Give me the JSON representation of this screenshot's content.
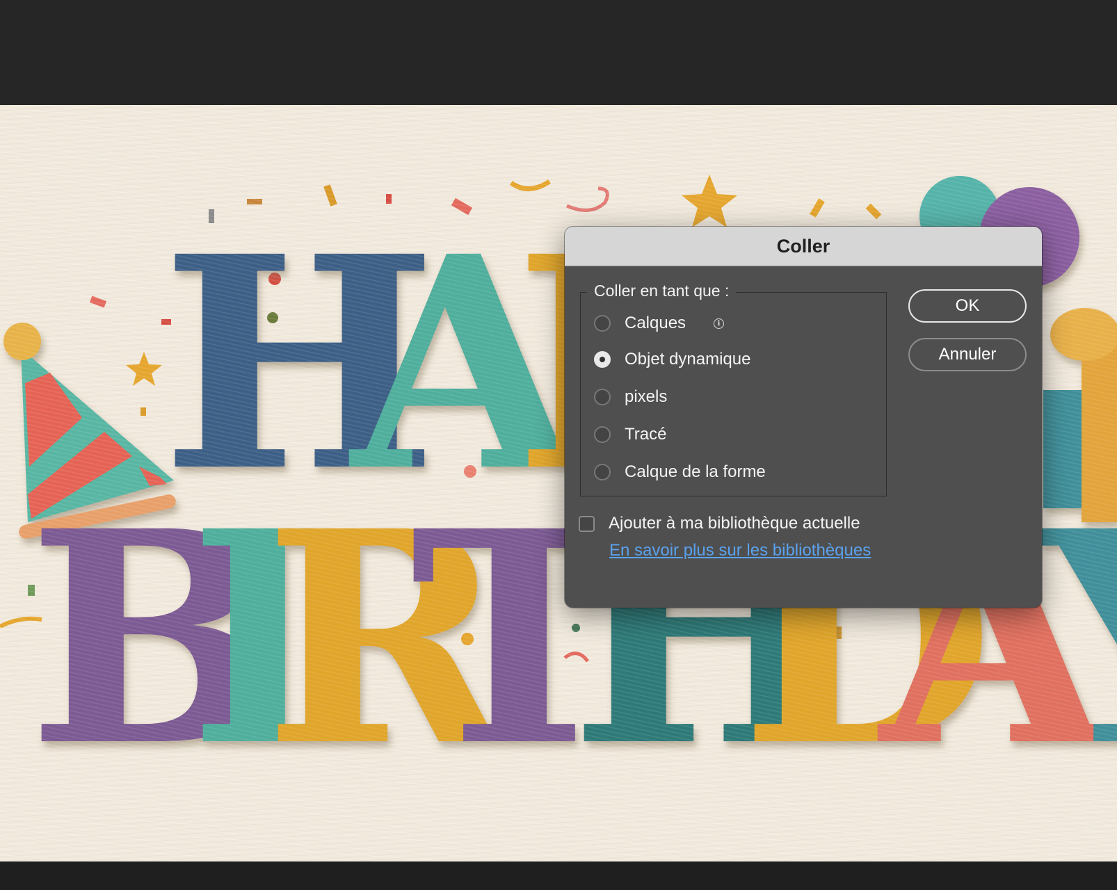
{
  "dialog": {
    "title": "Coller",
    "group_label": "Coller en tant que :",
    "options": [
      {
        "label": "Calques",
        "selected": false,
        "has_info_icon": true
      },
      {
        "label": "Objet dynamique",
        "selected": true,
        "has_info_icon": false
      },
      {
        "label": "pixels",
        "selected": false,
        "has_info_icon": false
      },
      {
        "label": "Tracé",
        "selected": false,
        "has_info_icon": false
      },
      {
        "label": "Calque de la forme",
        "selected": false,
        "has_info_icon": false
      }
    ],
    "checkbox_label": "Ajouter à ma bibliothèque actuelle",
    "checkbox_checked": false,
    "link_text": "En savoir plus sur les bibliothèques",
    "ok_label": "OK",
    "cancel_label": "Annuler",
    "info_icon": "i"
  },
  "canvas": {
    "artwork_description_icon": "embroidered-birthday-artwork",
    "line1_letters": [
      "H",
      "A",
      "P"
    ],
    "line2_letters": [
      "B",
      "I",
      "R",
      "T",
      "H",
      "D",
      "A",
      "Y"
    ]
  },
  "colors": {
    "app_background": "#262626",
    "paper": "#f1e9dc",
    "dialog_body": "#4f4f4f",
    "dialog_titlebar": "#d6d6d6",
    "link": "#5aa2ee",
    "thread_blue": "#3d5f86",
    "thread_teal": "#4fae9c",
    "thread_gold": "#e0a52c",
    "thread_purple": "#7b5a93",
    "thread_darkteal": "#2f7a78",
    "thread_coral": "#e06f5e"
  }
}
